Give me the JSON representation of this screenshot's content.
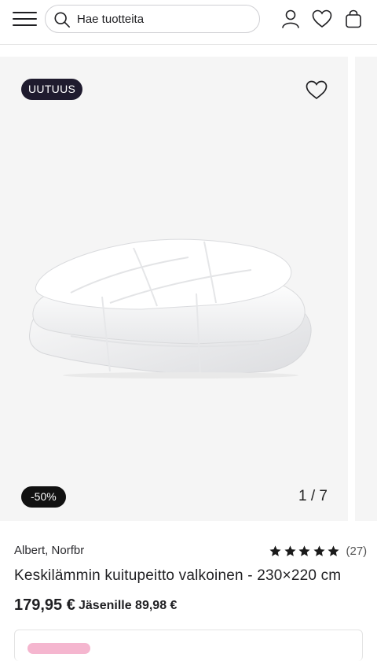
{
  "header": {
    "search": {
      "placeholder": "Hae tuotteita"
    },
    "icons": [
      "menu-icon",
      "search-icon",
      "user-icon",
      "heart-icon",
      "shopping-bag-icon"
    ]
  },
  "gallery": {
    "new_badge": "UUTUUS",
    "discount_badge": "-50%",
    "counter": "1 / 7",
    "image": "white-quilt-duvet"
  },
  "product": {
    "brand": "Albert, Norfbr",
    "rating": {
      "stars": 5,
      "count": "(27)"
    },
    "title": "Keskilämmin kuitupeitto valkoinen - 230×220 cm",
    "price": "179,95 €",
    "member_price": "Jäsenille 89,98 €"
  },
  "colors": {
    "dark_badge": "#1f1b2e",
    "gallery_bg": "#f5f5f5",
    "promo_pill": "#f5b6cf"
  }
}
